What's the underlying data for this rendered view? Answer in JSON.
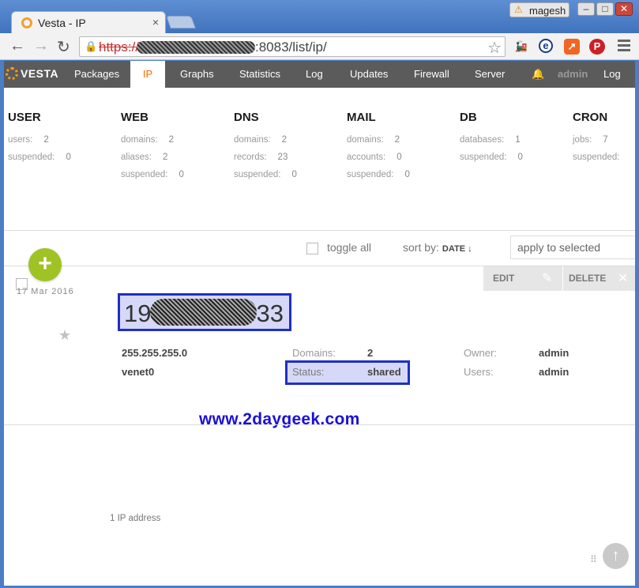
{
  "browser": {
    "tab_title": "Vesta - IP",
    "tab_close": "×",
    "profile_name": "magesh",
    "warning_glyph": "⚠",
    "minimize": "–",
    "maximize": "□",
    "close": "✕",
    "back": "←",
    "forward": "→",
    "reload": "↻",
    "url_protocol": "https://",
    "url_path": ":8083/list/ip/",
    "star": "☆",
    "extensions": [
      "train-icon",
      "e-icon",
      "chart-icon",
      "pinterest-icon"
    ]
  },
  "nav": {
    "logo": "VESTA",
    "items": [
      "Packages",
      "IP",
      "Graphs",
      "Statistics",
      "Log",
      "Updates",
      "Firewall",
      "Server"
    ],
    "active": "IP",
    "bell": "🔔",
    "user": "admin",
    "logout": "Log out"
  },
  "stats": [
    {
      "title": "USER",
      "rows": [
        {
          "label": "users:",
          "value": "2"
        },
        {
          "label": "suspended:",
          "value": "0"
        }
      ]
    },
    {
      "title": "WEB",
      "rows": [
        {
          "label": "domains:",
          "value": "2"
        },
        {
          "label": "aliases:",
          "value": "2"
        },
        {
          "label": "suspended:",
          "value": "0"
        }
      ]
    },
    {
      "title": "DNS",
      "rows": [
        {
          "label": "domains:",
          "value": "2"
        },
        {
          "label": "records:",
          "value": "23"
        },
        {
          "label": "suspended:",
          "value": "0"
        }
      ]
    },
    {
      "title": "MAIL",
      "rows": [
        {
          "label": "domains:",
          "value": "2"
        },
        {
          "label": "accounts:",
          "value": "0"
        },
        {
          "label": "suspended:",
          "value": "0"
        }
      ]
    },
    {
      "title": "DB",
      "rows": [
        {
          "label": "databases:",
          "value": "1"
        },
        {
          "label": "suspended:",
          "value": "0"
        }
      ]
    },
    {
      "title": "CRON",
      "rows": [
        {
          "label": "jobs:",
          "value": "7"
        },
        {
          "label": "suspended:",
          "value": ""
        }
      ]
    }
  ],
  "list_controls": {
    "toggle_all": "toggle all",
    "sort_by": "sort by:",
    "sort_field": "DATE ↓",
    "apply_placeholder": "apply to selected"
  },
  "add_button": "+",
  "ip_row": {
    "date": "17  Mar  2016",
    "star": "★",
    "ip_start": "19",
    "ip_end": "33",
    "netmask": "255.255.255.0",
    "interface": "venet0",
    "domains_label": "Domains:",
    "domains_value": "2",
    "status_label": "Status:",
    "status_value": "shared",
    "owner_label": "Owner:",
    "owner_value": "admin",
    "users_label": "Users:",
    "users_value": "admin",
    "edit": "EDIT",
    "edit_icon": "✎",
    "delete": "DELETE",
    "delete_icon": "✕"
  },
  "watermark": "www.2daygeek.com",
  "footer_count": "1 IP address",
  "to_top": "↑",
  "grip": "⠿"
}
